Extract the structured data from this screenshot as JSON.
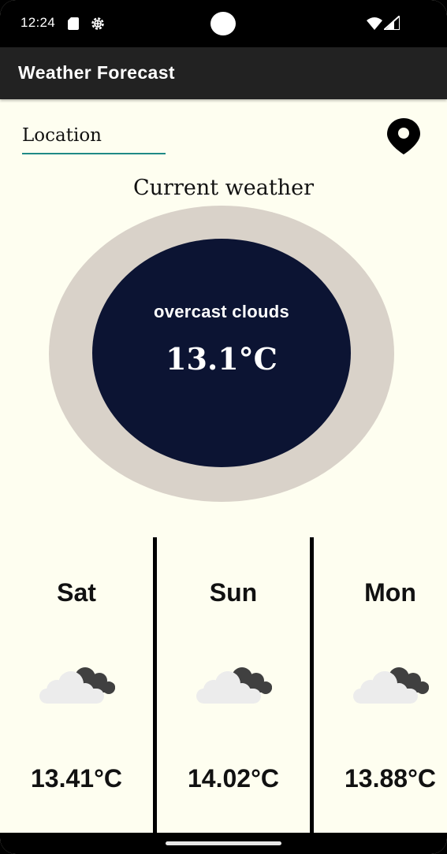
{
  "status_bar": {
    "time": "12:24",
    "icons": [
      "sd-card-icon",
      "gear-icon",
      "wifi-icon",
      "signal-icon"
    ]
  },
  "app_bar": {
    "title": "Weather Forecast"
  },
  "location": {
    "placeholder": "Location",
    "icon": "map-pin-icon"
  },
  "current": {
    "heading": "Current weather",
    "condition": "overcast clouds",
    "temperature": "13.1°C"
  },
  "forecast": [
    {
      "day": "Sat",
      "icon": "overcast-clouds-icon",
      "temperature": "13.41°C"
    },
    {
      "day": "Sun",
      "icon": "overcast-clouds-icon",
      "temperature": "14.02°C"
    },
    {
      "day": "Mon",
      "icon": "overcast-clouds-icon",
      "temperature": "13.88°C"
    }
  ],
  "colors": {
    "background": "#fefef0",
    "app_bar": "#222222",
    "ring": "#d9d2c9",
    "disc": "#0c1433",
    "underline": "#1f8a86"
  }
}
